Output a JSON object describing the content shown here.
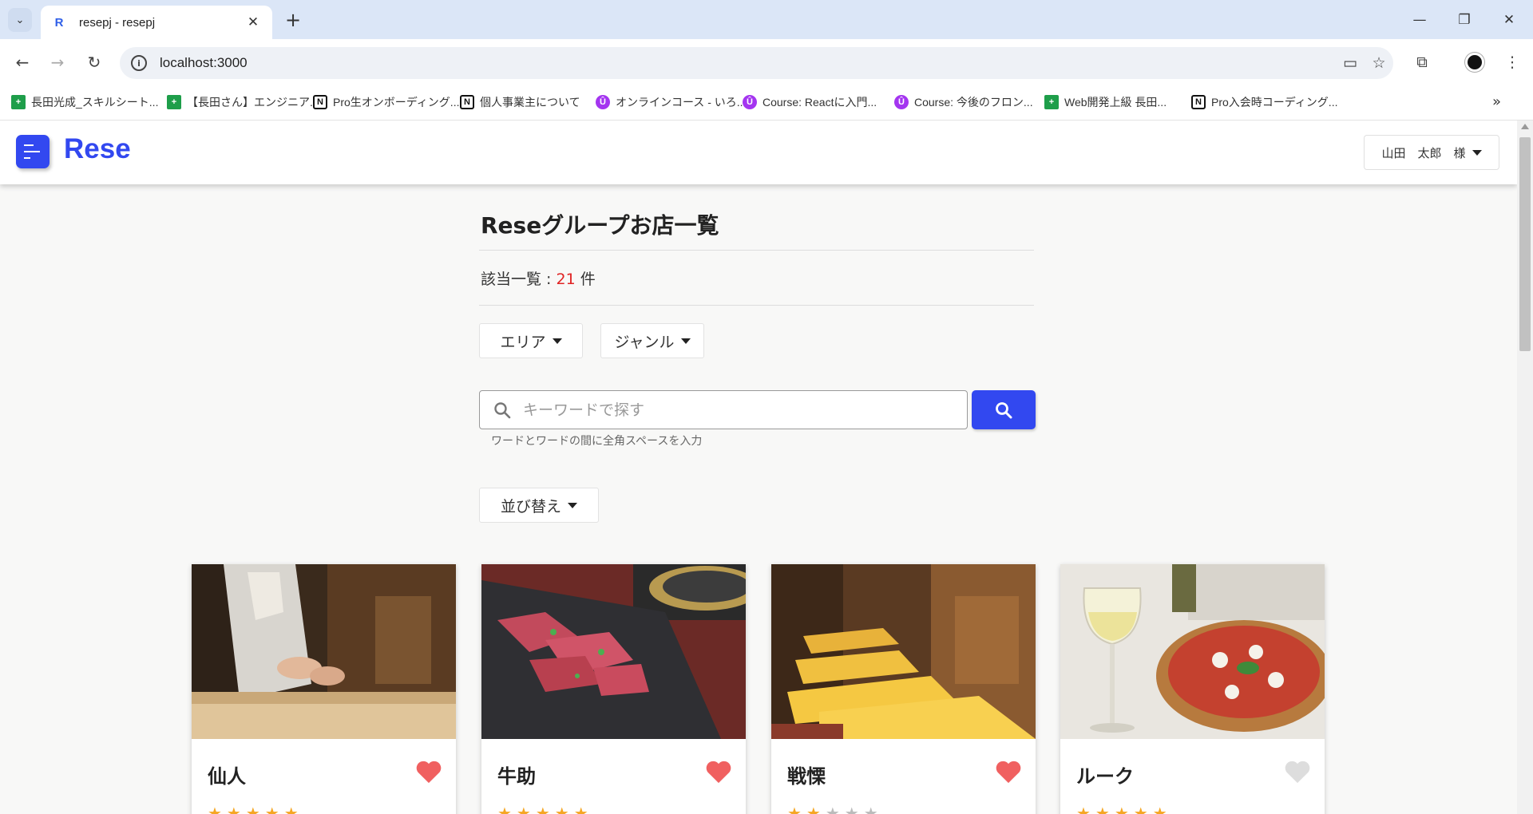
{
  "browser": {
    "tab_title": "resepj - resepj",
    "tab_favicon": "R",
    "url": "localhost:3000",
    "bookmarks": [
      {
        "label": "長田光成_スキルシート...",
        "icon": "sheets-icon"
      },
      {
        "label": "【長田さん】エンジニア...",
        "icon": "sheets-icon"
      },
      {
        "label": "Pro生オンボーディング...",
        "icon": "notion-icon"
      },
      {
        "label": "個人事業主について",
        "icon": "notion-icon"
      },
      {
        "label": "オンラインコース - いろ...",
        "icon": "udemy-icon"
      },
      {
        "label": "Course: Reactに入門...",
        "icon": "udemy-icon"
      },
      {
        "label": "Course: 今後のフロン...",
        "icon": "udemy-icon"
      },
      {
        "label": "Web開発上級 長田...",
        "icon": "sheets-icon"
      },
      {
        "label": "Pro入会時コーディング...",
        "icon": "notion-icon"
      }
    ]
  },
  "app": {
    "logo_text": "Rese",
    "brand_color": "#3248f0",
    "user_label": "山田　太郎　様"
  },
  "main": {
    "title": "Reseグループお店一覧",
    "count_prefix": "該当一覧 : ",
    "count_value": "21",
    "count_suffix": " 件",
    "area_label": "エリア",
    "genre_label": "ジャンル",
    "search_placeholder": "キーワードで探す",
    "search_hint": "ワードとワードの間に全角スペースを入力",
    "sort_label": "並び替え"
  },
  "shops": [
    {
      "name": "仙人",
      "favorite": true,
      "rating": 5,
      "photo": "sushi-chef"
    },
    {
      "name": "牛助",
      "favorite": true,
      "rating": 5,
      "photo": "yakiniku-beef"
    },
    {
      "name": "戦慄",
      "favorite": true,
      "rating": 2,
      "photo": "izakaya-interior"
    },
    {
      "name": "ルーク",
      "favorite": false,
      "rating": 5,
      "photo": "pizza-wine"
    }
  ],
  "colors": {
    "favorite_on": "#f06060",
    "favorite_off": "#dddddd",
    "count_accent": "#e02424"
  }
}
